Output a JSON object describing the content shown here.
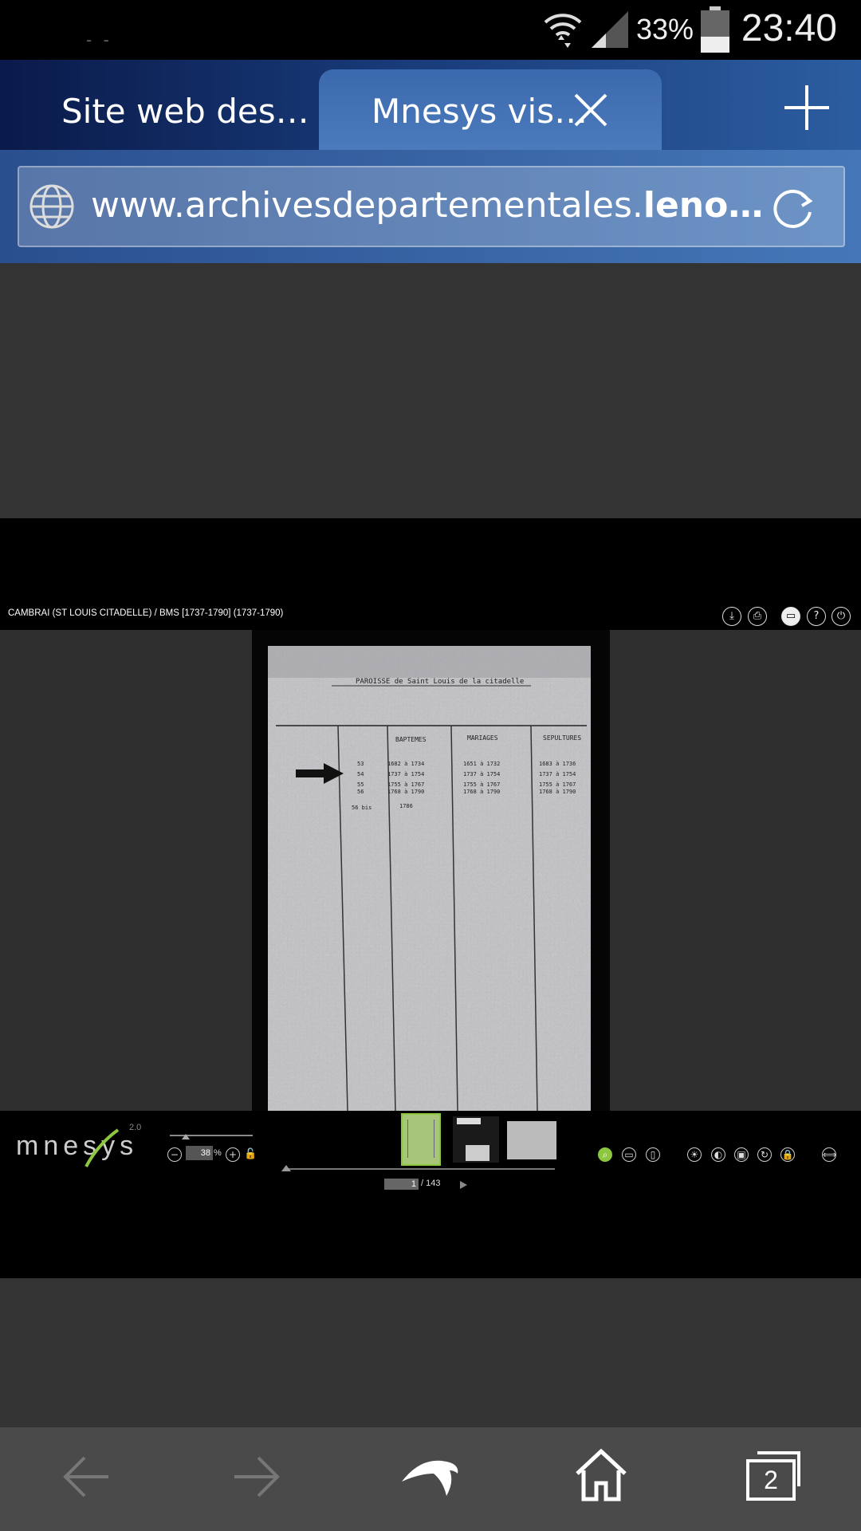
{
  "status_bar": {
    "time": "23:40",
    "battery_percent": "33%",
    "notif": "- -",
    "icons": [
      "wifi-icon",
      "signal-icon",
      "battery-icon"
    ]
  },
  "tabs": [
    {
      "label": "Site web des…",
      "active": false
    },
    {
      "label": "Mnesys vis…",
      "active": true
    }
  ],
  "address_bar": {
    "url_prefix": "www.archivesdepartementales.",
    "url_bold": "leno…"
  },
  "viewer": {
    "document_title": "CAMBRAI (ST LOUIS CITADELLE) / BMS [1737-1790] (1737-1790)",
    "toolbar_icons": [
      "download-icon",
      "print-icon",
      "fullscreen-icon",
      "help-icon",
      "power-icon"
    ],
    "logo_text": "mnesys",
    "logo_version": "2.0",
    "zoom_value": "38",
    "zoom_unit": "%",
    "page_current": "1",
    "page_total": "/ 143",
    "document_header": "PAROISSE de Saint Louis de la citadelle",
    "document_columns": [
      "BAPTEMES",
      "MARIAGES",
      "SEPULTURES"
    ],
    "document_rows": [
      [
        "53",
        "1682 à 1734",
        "1651 à 1732",
        "1683 à 1736"
      ],
      [
        "54",
        "1737 à 1754",
        "1737 à 1754",
        "1737 à 1754"
      ],
      [
        "55",
        "1755 à 1767",
        "1755 à 1767",
        "1755 à 1767"
      ],
      [
        "56",
        "1768 à 1790",
        "1768 à 1790",
        "1768 à 1790"
      ],
      [
        "56 bis",
        "1786",
        "",
        ""
      ]
    ],
    "accent_color": "#8dc63f"
  },
  "bottom_nav": {
    "tab_count": "2"
  }
}
